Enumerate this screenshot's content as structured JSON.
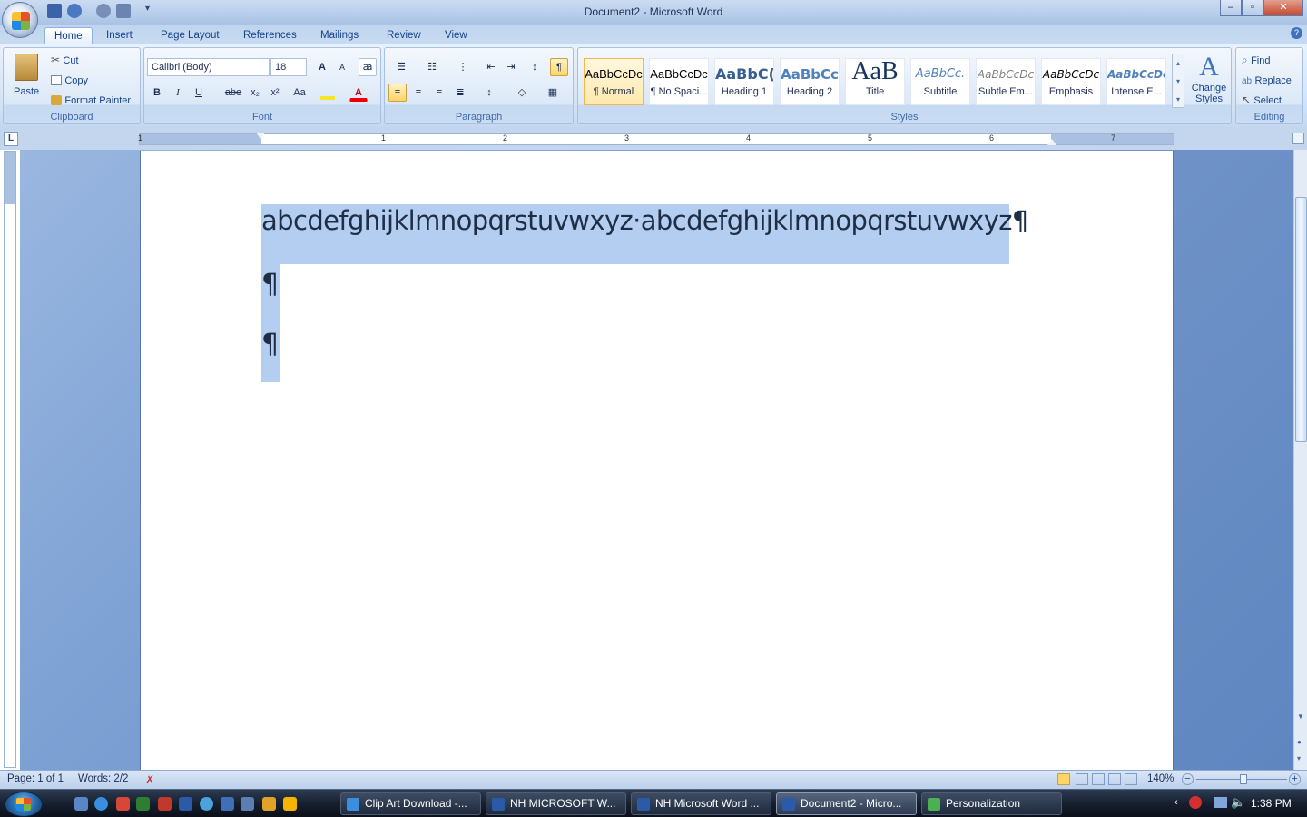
{
  "window": {
    "title": "Document2 - Microsoft Word",
    "controls": [
      "–",
      "▫",
      "✕"
    ]
  },
  "tabs": [
    {
      "label": "Home",
      "active": true
    },
    {
      "label": "Insert"
    },
    {
      "label": "Page Layout"
    },
    {
      "label": "References"
    },
    {
      "label": "Mailings"
    },
    {
      "label": "Review"
    },
    {
      "label": "View"
    }
  ],
  "ribbon": {
    "clipboard": {
      "label": "Clipboard",
      "paste": "Paste",
      "cut": "Cut",
      "copy": "Copy",
      "format_painter": "Format Painter"
    },
    "font": {
      "label": "Font",
      "family": "Calibri (Body)",
      "size": "18",
      "grow": "A",
      "shrink": "A",
      "bold": "B",
      "italic": "I",
      "underline": "U",
      "strike": "abe",
      "subscript": "x₂",
      "superscript": "x²",
      "change_case": "Aa",
      "font_color": "A"
    },
    "paragraph": {
      "label": "Paragraph",
      "show_marks": "¶"
    },
    "styles": {
      "label": "Styles",
      "items": [
        {
          "preview": "AaBbCcDc",
          "name": "¶ Normal",
          "selected": true
        },
        {
          "preview": "AaBbCcDc",
          "name": "¶ No Spaci..."
        },
        {
          "preview": "AaBbC(",
          "name": "Heading 1"
        },
        {
          "preview": "AaBbCc",
          "name": "Heading 2"
        },
        {
          "preview": "AaB",
          "name": "Title"
        },
        {
          "preview": "AaBbCc.",
          "name": "Subtitle"
        },
        {
          "preview": "AaBbCcDc",
          "name": "Subtle Em..."
        },
        {
          "preview": "AaBbCcDc",
          "name": "Emphasis"
        },
        {
          "preview": "AaBbCcDc",
          "name": "Intense E..."
        }
      ],
      "change_styles": "Change Styles"
    },
    "editing": {
      "label": "Editing",
      "find": "Find",
      "replace": "Replace",
      "select": "Select"
    }
  },
  "ruler": {
    "numbers": [
      "1",
      "1",
      "2",
      "3",
      "4",
      "5",
      "6",
      "7"
    ]
  },
  "document": {
    "line1": "abcdefghijklmnopqrstuvwxyz·abcdefghijklmnopqrstuvwxyz¶",
    "para_mark": "¶"
  },
  "status": {
    "page": "Page: 1 of 1",
    "words": "Words: 2/2",
    "zoom": "140%"
  },
  "taskbar": {
    "buttons": [
      {
        "label": "Clip Art Download -..."
      },
      {
        "label": "NH MICROSOFT W..."
      },
      {
        "label": "NH Microsoft Word ..."
      },
      {
        "label": "Document2 - Micro...",
        "active": true
      },
      {
        "label": "Personalization"
      }
    ],
    "clock": "1:38 PM"
  },
  "colors": {
    "selection": "#b3cef0",
    "ribbon_text": "#15428b"
  }
}
